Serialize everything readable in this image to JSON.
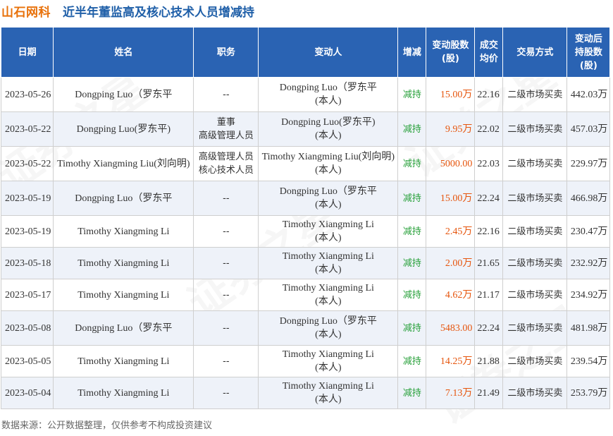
{
  "header": {
    "brand": "山石网科",
    "title": "近半年董监高及核心技术人员增减持"
  },
  "columns": [
    "日期",
    "姓名",
    "职务",
    "变动人",
    "增减",
    "变动股数(股)",
    "成交均价",
    "交易方式",
    "变动后持股数(股)"
  ],
  "rows": [
    {
      "date": "2023-05-26",
      "name": "Dongping Luo（罗东平",
      "position": "--",
      "changer": "Dongping Luo（罗东平\n(本人)",
      "direction": "减持",
      "shares": "15.00万",
      "price": "22.16",
      "method": "二级市场买卖",
      "after": "442.03万"
    },
    {
      "date": "2023-05-22",
      "name": "Dongping Luo(罗东平)",
      "position": "董事\n高级管理人员",
      "changer": "Dongping Luo(罗东平)\n(本人)",
      "direction": "减持",
      "shares": "9.95万",
      "price": "22.02",
      "method": "二级市场买卖",
      "after": "457.03万"
    },
    {
      "date": "2023-05-22",
      "name": "Timothy Xiangming Liu(刘向明)",
      "position": "高级管理人员\n核心技术人员",
      "changer": "Timothy Xiangming Liu(刘向明)\n(本人)",
      "direction": "减持",
      "shares": "5000.00",
      "price": "22.03",
      "method": "二级市场买卖",
      "after": "229.97万"
    },
    {
      "date": "2023-05-19",
      "name": "Dongping Luo（罗东平",
      "position": "--",
      "changer": "Dongping Luo（罗东平\n(本人)",
      "direction": "减持",
      "shares": "15.00万",
      "price": "22.24",
      "method": "二级市场买卖",
      "after": "466.98万"
    },
    {
      "date": "2023-05-19",
      "name": "Timothy Xiangming Li",
      "position": "--",
      "changer": "Timothy Xiangming Li\n(本人)",
      "direction": "减持",
      "shares": "2.45万",
      "price": "22.16",
      "method": "二级市场买卖",
      "after": "230.47万"
    },
    {
      "date": "2023-05-18",
      "name": "Timothy Xiangming Li",
      "position": "--",
      "changer": "Timothy Xiangming Li\n(本人)",
      "direction": "减持",
      "shares": "2.00万",
      "price": "21.65",
      "method": "二级市场买卖",
      "after": "232.92万"
    },
    {
      "date": "2023-05-17",
      "name": "Timothy Xiangming Li",
      "position": "--",
      "changer": "Timothy Xiangming Li\n(本人)",
      "direction": "减持",
      "shares": "4.62万",
      "price": "21.17",
      "method": "二级市场买卖",
      "after": "234.92万"
    },
    {
      "date": "2023-05-08",
      "name": "Dongping Luo（罗东平",
      "position": "--",
      "changer": "Dongping Luo（罗东平\n(本人)",
      "direction": "减持",
      "shares": "5483.00",
      "price": "22.24",
      "method": "二级市场买卖",
      "after": "481.98万"
    },
    {
      "date": "2023-05-05",
      "name": "Timothy Xiangming Li",
      "position": "--",
      "changer": "Timothy Xiangming Li\n(本人)",
      "direction": "减持",
      "shares": "14.25万",
      "price": "21.88",
      "method": "二级市场买卖",
      "after": "239.54万"
    },
    {
      "date": "2023-05-04",
      "name": "Timothy Xiangming Li",
      "position": "--",
      "changer": "Timothy Xiangming Li\n(本人)",
      "direction": "减持",
      "shares": "7.13万",
      "price": "21.49",
      "method": "二级市场买卖",
      "after": "253.79万"
    }
  ],
  "footer": "数据来源：公开数据整理，仅供参考不构成投资建议",
  "watermark": "证券之星",
  "colors": {
    "header_bg": "#2a63b3",
    "brand": "#e8710a",
    "title": "#1f5fa8",
    "decrease": "#27a03a",
    "shares": "#e6550d",
    "alt_row": "#eef2f9"
  }
}
